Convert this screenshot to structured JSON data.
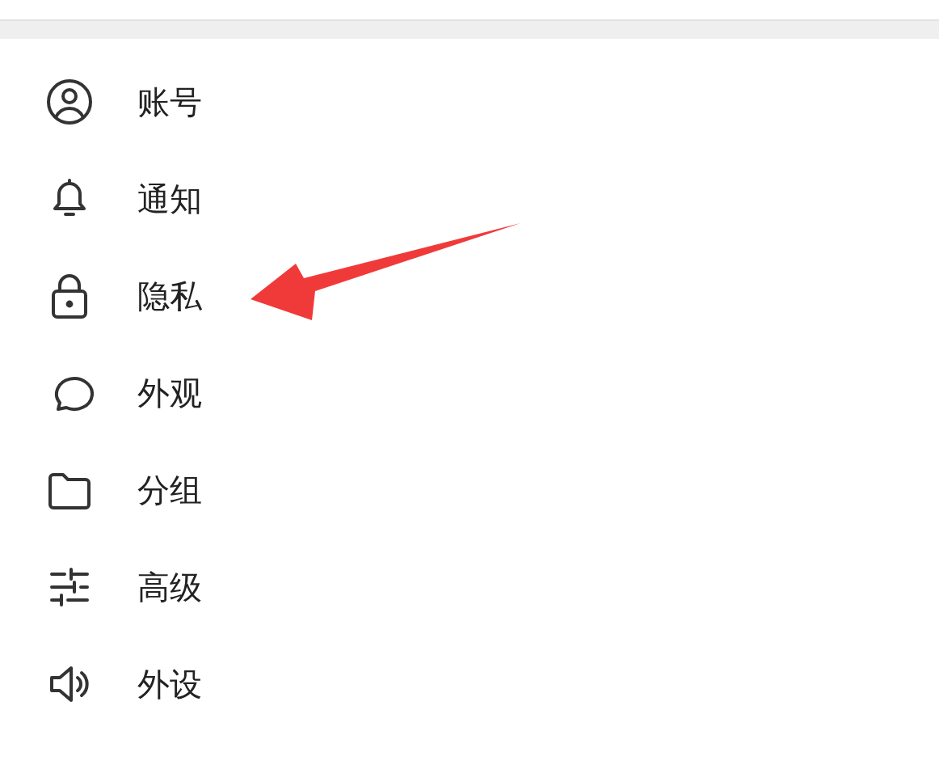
{
  "menu": [
    {
      "label": "账号"
    },
    {
      "label": "通知"
    },
    {
      "label": "隐私"
    },
    {
      "label": "外观"
    },
    {
      "label": "分组"
    },
    {
      "label": "高级"
    },
    {
      "label": "外设"
    }
  ],
  "annotations": [
    {
      "kind": "arrow",
      "color": "#f03a3a"
    }
  ]
}
